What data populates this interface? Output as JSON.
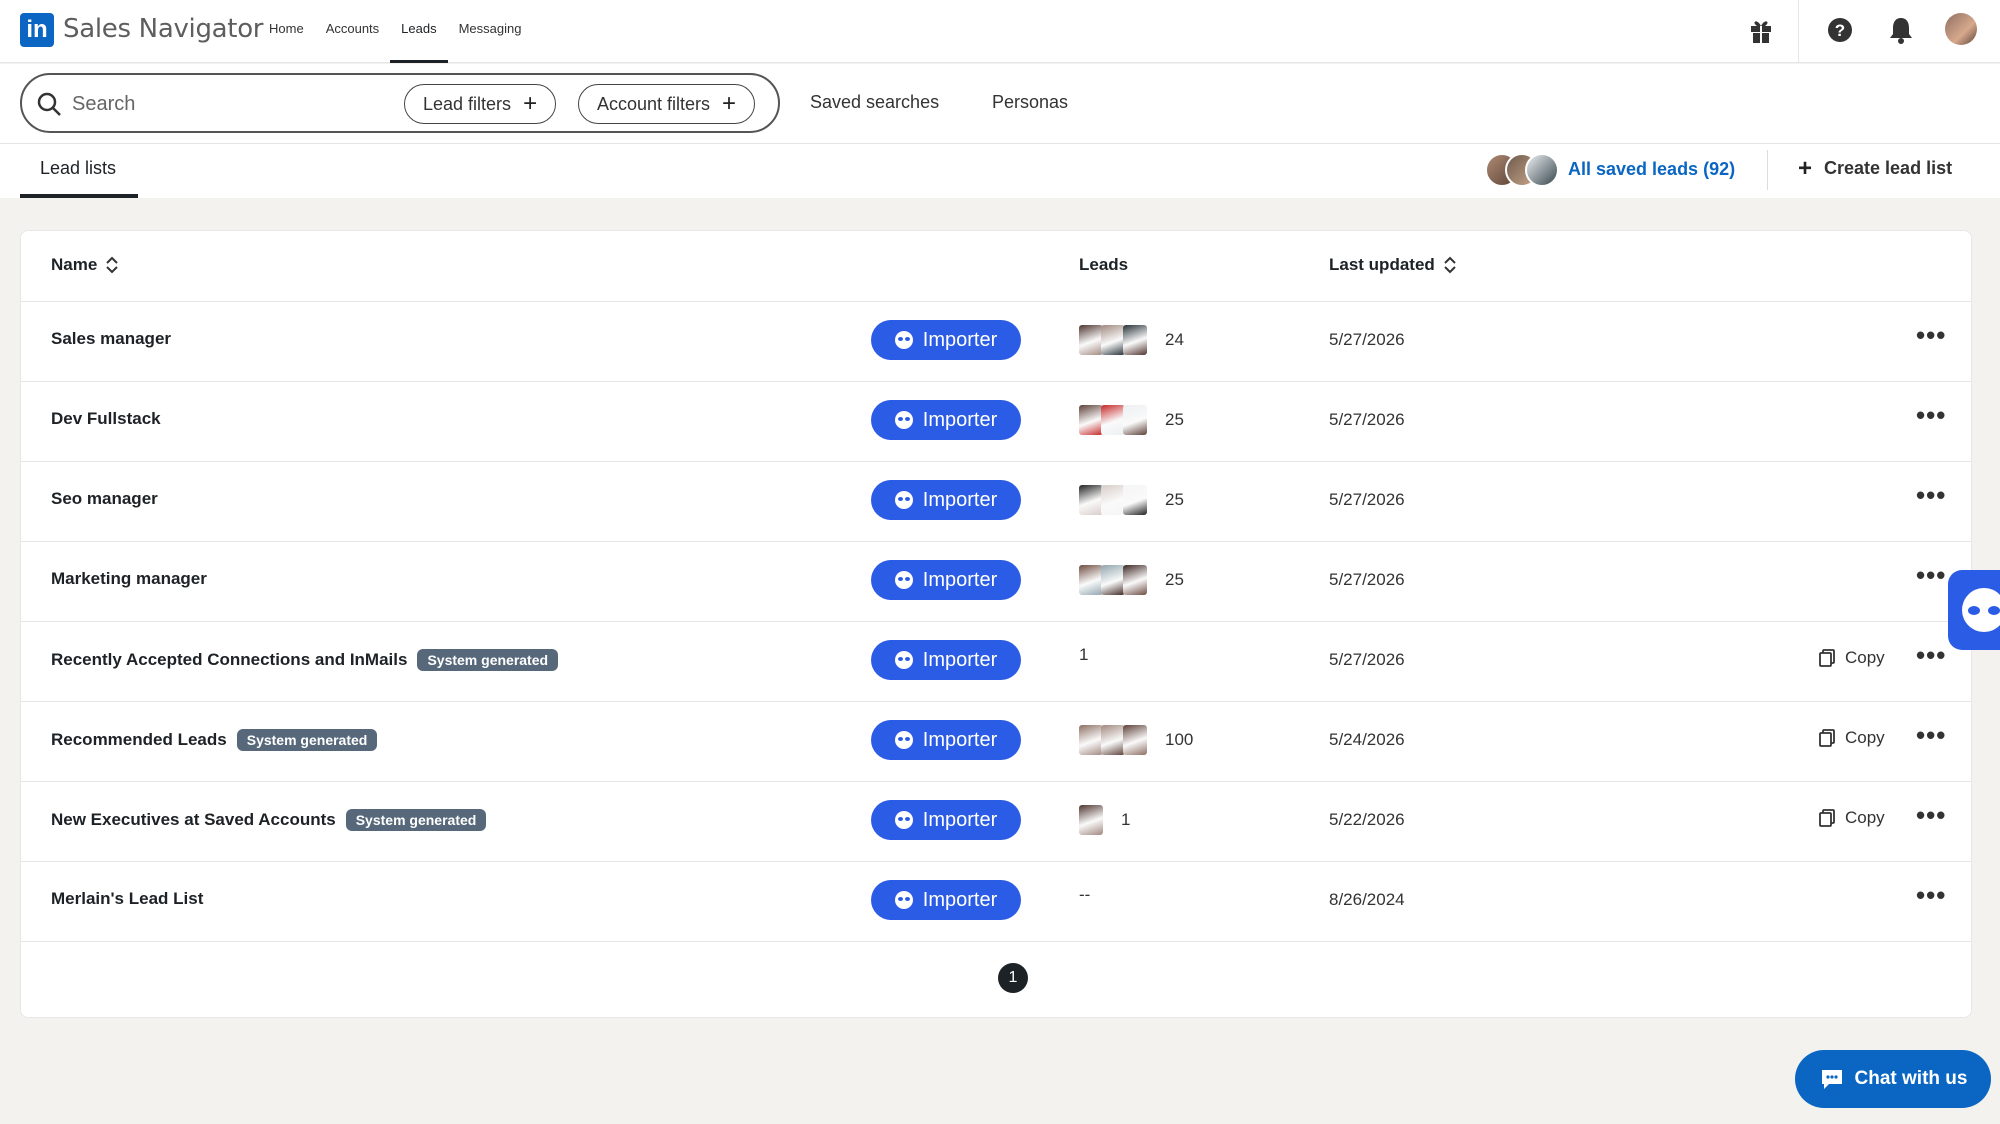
{
  "topnav": {
    "logo_text": "in",
    "brand": "Sales Navigator",
    "links": [
      "Home",
      "Accounts",
      "Leads",
      "Messaging"
    ],
    "active_link": "Leads",
    "icons": [
      "gift-icon",
      "help-icon",
      "bell-icon",
      "avatar"
    ]
  },
  "search": {
    "placeholder": "Search",
    "lead_filters": "Lead filters",
    "account_filters": "Account filters",
    "saved_searches": "Saved searches",
    "personas": "Personas"
  },
  "subnav": {
    "tab": "Lead lists",
    "all_saved_leads": "All saved leads (92)",
    "create_lead_list": "Create lead list"
  },
  "table": {
    "headers": {
      "name": "Name",
      "leads": "Leads",
      "last_updated": "Last updated"
    },
    "importer_label": "Importer",
    "copy_label": "Copy",
    "rows": [
      {
        "name": "Sales manager",
        "badge": "",
        "leads": "24",
        "faces": 3,
        "date": "5/27/2026",
        "copy": false
      },
      {
        "name": "Dev Fullstack",
        "badge": "",
        "leads": "25",
        "faces": 3,
        "date": "5/27/2026",
        "copy": false
      },
      {
        "name": "Seo manager",
        "badge": "",
        "leads": "25",
        "faces": 3,
        "date": "5/27/2026",
        "copy": false
      },
      {
        "name": "Marketing manager",
        "badge": "",
        "leads": "25",
        "faces": 3,
        "date": "5/27/2026",
        "copy": false
      },
      {
        "name": "Recently Accepted Connections and InMails",
        "badge": "System generated",
        "leads": "1",
        "faces": 0,
        "date": "5/27/2026",
        "copy": true
      },
      {
        "name": "Recommended Leads",
        "badge": "System generated",
        "leads": "100",
        "faces": 3,
        "date": "5/24/2026",
        "copy": true
      },
      {
        "name": "New Executives at Saved Accounts",
        "badge": "System generated",
        "leads": "1",
        "faces": 1,
        "date": "5/22/2026",
        "copy": true
      },
      {
        "name": "Merlain's Lead List",
        "badge": "",
        "leads": "--",
        "faces": 0,
        "date": "8/26/2024",
        "copy": false
      }
    ],
    "page": "1"
  },
  "chat": {
    "label": "Chat with us"
  },
  "colors": {
    "brand_blue": "#0a66c2",
    "importer_blue": "#2b5ce6",
    "badge_gray": "#56687a"
  }
}
